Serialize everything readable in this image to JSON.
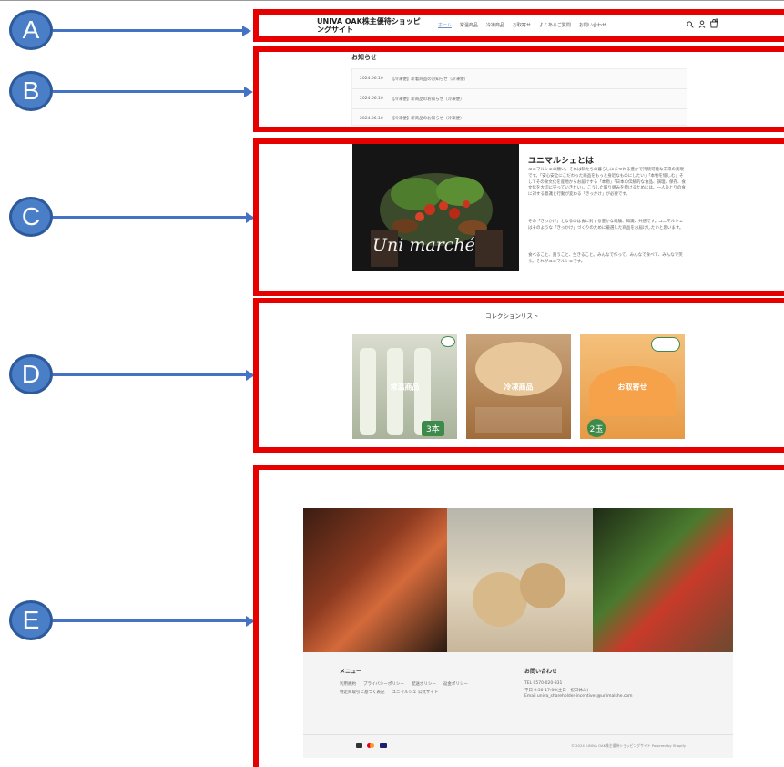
{
  "callouts": [
    "A",
    "B",
    "C",
    "D",
    "E"
  ],
  "header": {
    "title": "UNIVA OAK株主優待ショッピングサイト",
    "nav": [
      "ホーム",
      "常温商品",
      "冷凍商品",
      "お取寄せ",
      "よくあるご質問",
      "お問い合わせ"
    ],
    "icons": [
      "search-icon",
      "user-icon",
      "cart-icon"
    ],
    "cart_count": "0"
  },
  "news": {
    "heading": "お知らせ",
    "items": [
      {
        "date": "2024.06.10",
        "text": "【冷凍便】新着商品のお知らせ（冷凍便）"
      },
      {
        "date": "2024.06.10",
        "text": "【冷凍便】新商品のお知らせ（冷凍便）"
      },
      {
        "date": "2024.06.10",
        "text": "【冷凍便】新商品のお知らせ（冷凍便）"
      }
    ]
  },
  "about": {
    "heading": "ユニマルシェとは",
    "logo_text": "Uni marché",
    "paragraphs": [
      "ユニマルシェの願い。それは私たちの暮らしにまつわる豊かで持続可能な未来の実現です。「安心安全にこだわった商品をもっと身近なものにしたい」「本物を愉しむ」そしてその食文化を産地からお届けする「本物」「日本の伝統的な食品、調理、保存、食文化を大切に守っていきたい」。こうした取り組みを続けるためには、一人ひとりの食に対する意識と行動が変わる「きっかけ」が必要です。",
      "その「きっかけ」となるのは食に対する豊かな経験、知識、共感です。ユニマルシェはそのような「きっかけ」づくりのために厳選した商品をお届けしたいと思います。",
      "食べること、買うこと、生きること。みんなで作って、みんなで食べて、みんなで笑う。それがユニマルシェです。"
    ]
  },
  "collections": {
    "heading": "コレクションリスト",
    "items": [
      {
        "label": "常温商品",
        "badge": "3本",
        "colors": [
          "#d9dccf",
          "#a9b39b"
        ]
      },
      {
        "label": "冷凍商品",
        "badge": "",
        "colors": [
          "#c9a37a",
          "#a16c3b"
        ]
      },
      {
        "label": "お取寄せ",
        "badge": "2玉",
        "colors": [
          "#f4c07b",
          "#e89a45"
        ]
      }
    ]
  },
  "footer": {
    "menu_heading": "メニュー",
    "menu_items": [
      "利用規約",
      "プライバシーポリシー",
      "配送ポリシー",
      "返金ポリシー",
      "特定商取引に基づく表記",
      "ユニマルシェ 公式サイト"
    ],
    "contact_heading": "お問い合わせ",
    "contact_lines": [
      "TEL 0570-020-331",
      "平日 9:30-17:00(土日・祝日休み)",
      "Email univa_shareholder-incentives@unimalshe.com"
    ],
    "payment_icons": [
      "card-icon",
      "mastercard-icon",
      "visa-icon"
    ],
    "copyright": "© 2024, UNIVA OAK株主優待ショッピングサイト Powered by Shopify"
  }
}
